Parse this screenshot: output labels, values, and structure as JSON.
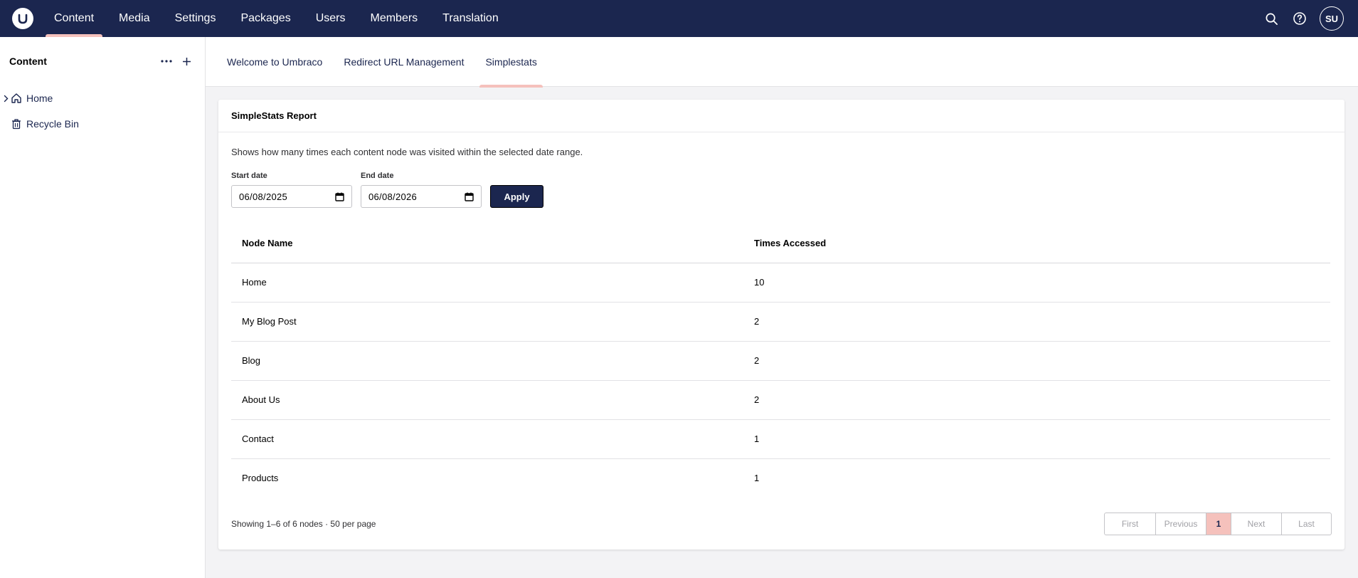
{
  "topbar": {
    "nav": [
      "Content",
      "Media",
      "Settings",
      "Packages",
      "Users",
      "Members",
      "Translation"
    ],
    "active_nav": "Content",
    "avatar_initials": "SU",
    "colors": {
      "bar": "#1b264f",
      "accent": "#f5c1bc"
    }
  },
  "sidebar": {
    "title": "Content",
    "items": [
      {
        "label": "Home",
        "icon": "home-icon"
      },
      {
        "label": "Recycle Bin",
        "icon": "trash-icon"
      }
    ]
  },
  "tabs": [
    "Welcome to Umbraco",
    "Redirect URL Management",
    "Simplestats"
  ],
  "active_tab": "Simplestats",
  "report": {
    "title": "SimpleStats Report",
    "description": "Shows how many times each content node was visited within the selected date range.",
    "start_label": "Start date",
    "start_value": "06/08/2025",
    "end_label": "End date",
    "end_value": "06/08/2026",
    "apply_label": "Apply",
    "columns": [
      "Node Name",
      "Times Accessed"
    ],
    "rows": [
      [
        "Home",
        "10"
      ],
      [
        "My Blog Post",
        "2"
      ],
      [
        "Blog",
        "2"
      ],
      [
        "About Us",
        "2"
      ],
      [
        "Contact",
        "1"
      ],
      [
        "Products",
        "1"
      ]
    ],
    "showing": "Showing 1–6 of 6 nodes · 50 per page",
    "pager": {
      "first": "First",
      "previous": "Previous",
      "current": "1",
      "next": "Next",
      "last": "Last"
    }
  }
}
